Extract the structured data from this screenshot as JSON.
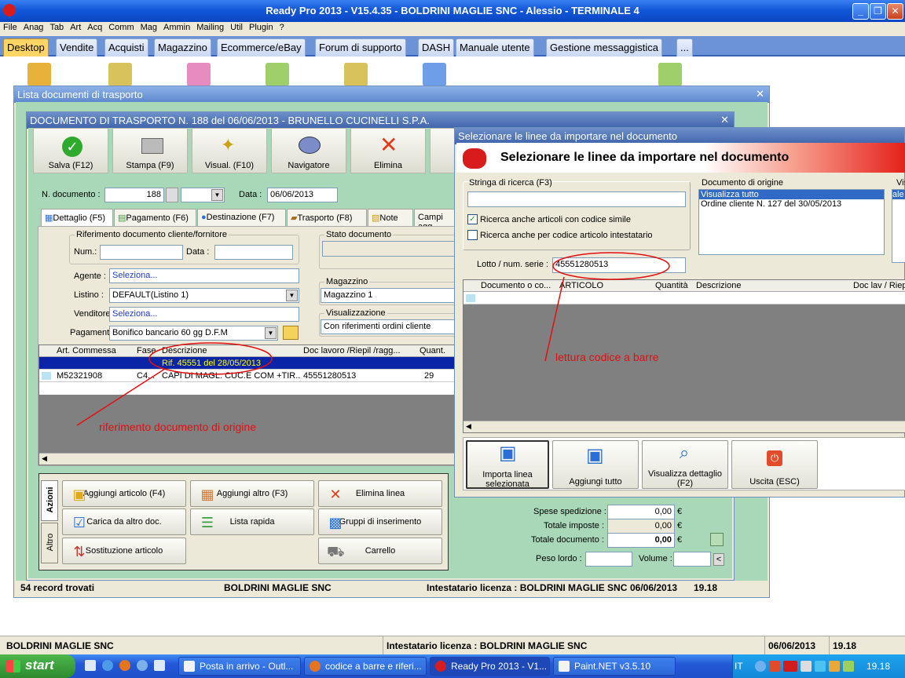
{
  "app": {
    "title": "Ready Pro 2013 - V15.4.35 - BOLDRINI MAGLIE SNC - Alessio - TERMINALE 4"
  },
  "menu": [
    "File",
    "Anag",
    "Tab",
    "Art",
    "Acq",
    "Comm",
    "Mag",
    "Ammin",
    "Mailing",
    "Util",
    "Plugin",
    "?"
  ],
  "main_tabs": [
    "Desktop",
    "Vendite",
    "Acquisti",
    "Magazzino",
    "Ecommerce/eBay",
    "Forum di supporto",
    "DASH",
    "Manuale utente",
    "Gestione messaggistica",
    "..."
  ],
  "lista": {
    "title": "Lista documenti di trasporto",
    "records": "54 record trovati",
    "company": "BOLDRINI MAGLIE SNC",
    "license": "Intestatario licenza : BOLDRINI MAGLIE SNC",
    "date": "06/06/2013",
    "time": "19.18"
  },
  "doc": {
    "title": "DOCUMENTO DI TRASPORTO N. 188 del 06/06/2013 - BRUNELLO CUCINELLI S.P.A.",
    "toolbar": [
      "Salva (F12)",
      "Stampa (F9)",
      "Visual. (F10)",
      "Navigatore",
      "Elimina"
    ],
    "n_doc_label": "N. documento :",
    "n_doc_value": "188",
    "data_label": "Data :",
    "data_value": "06/06/2013",
    "subtabs": [
      "Dettaglio (F5)",
      "Pagamento (F6)",
      "Destinazione (F7)",
      "Trasporto (F8)",
      "Note",
      "Campi agg"
    ],
    "rif_title": "Riferimento documento cliente/fornitore",
    "num_label": "Num.:",
    "data2_label": "Data :",
    "agente_label": "Agente :",
    "agente_value": "Seleziona...",
    "listino_label": "Listino :",
    "listino_value": "DEFAULT(Listino 1)",
    "venditore_label": "Venditore :",
    "venditore_value": "Seleziona...",
    "pagamento_label": "Pagamento :",
    "pagamento_value": "Bonifico bancario 60 gg D.F.M",
    "stato_label": "Stato documento",
    "magazzino_label": "Magazzino",
    "magazzino_value": "Magazzino 1",
    "visual_label": "Visualizzazione",
    "visual_value": "Con riferimenti ordini cliente",
    "grid_headers": [
      "Art. Commessa",
      "Fase",
      "Descrizione",
      "Doc lavoro /Riepil /ragg...",
      "Quant."
    ],
    "grid_row1": {
      "desc": "Rif. 45551 del 28/05/2013"
    },
    "grid_row2": {
      "art": "M52321908",
      "fase": "C4...",
      "desc": "CAPI DI MAGL. CUC.E COM +TIR...",
      "doc": "45551280513",
      "qty": "29"
    },
    "side_tabs": [
      "Azioni",
      "Altro"
    ],
    "actions": [
      "Aggiungi articolo (F4)",
      "Aggiungi altro (F3)",
      "Elimina linea",
      "Carica da altro doc.",
      "Lista rapida",
      "Gruppi di inserimento",
      "Sostituzione articolo",
      "Carrello"
    ],
    "totals": {
      "spese_sped_label": "Spese spedizione :",
      "spese_sped": "0,00",
      "tot_imp_label": "Totale imposte :",
      "tot_imp": "0,00",
      "tot_doc_label": "Totale documento :",
      "tot_doc": "0,00",
      "currency": "€",
      "peso_label": "Peso lordo :",
      "volume_label": "Volume :"
    }
  },
  "sel": {
    "title": "Selezionare le linee da importare nel documento",
    "header": "Selezionare le linee da importare nel documento",
    "search_label": "Stringa di ricerca (F3)",
    "chk1": "Ricerca anche articoli con codice simile",
    "chk2": "Ricerca anche per codice articolo intestatario",
    "lotto_label": "Lotto / num. serie :",
    "lotto_value": "45551280513",
    "origin_label": "Documento di origine",
    "origin_items": [
      "Visualizza tutto",
      "Ordine cliente N. 127 del 30/05/2013"
    ],
    "vis_label": "Vis",
    "vis_item": "ale",
    "grid_headers": [
      "Documento o co...",
      "ARTICOLO",
      "Quantità",
      "Descrizione",
      "Doc lav / Riep"
    ],
    "buttons": [
      "Importa linea selezionata",
      "Aggiungi tutto",
      "Visualizza dettaglio (F2)",
      "Uscita (ESC)"
    ]
  },
  "annotations": {
    "a1": "lettura codice a barre",
    "a2": "riferimento documento di origine"
  },
  "status": {
    "company": "BOLDRINI MAGLIE SNC",
    "license": "Intestatario licenza : BOLDRINI MAGLIE SNC",
    "date": "06/06/2013",
    "time": "19.18"
  },
  "taskbar": {
    "start": "start",
    "tasks": [
      "Posta in arrivo - Outl...",
      "codice a barre e riferi...",
      "Ready Pro 2013 - V1...",
      "Paint.NET v3.5.10"
    ],
    "lang": "IT",
    "clock": "19.18"
  }
}
